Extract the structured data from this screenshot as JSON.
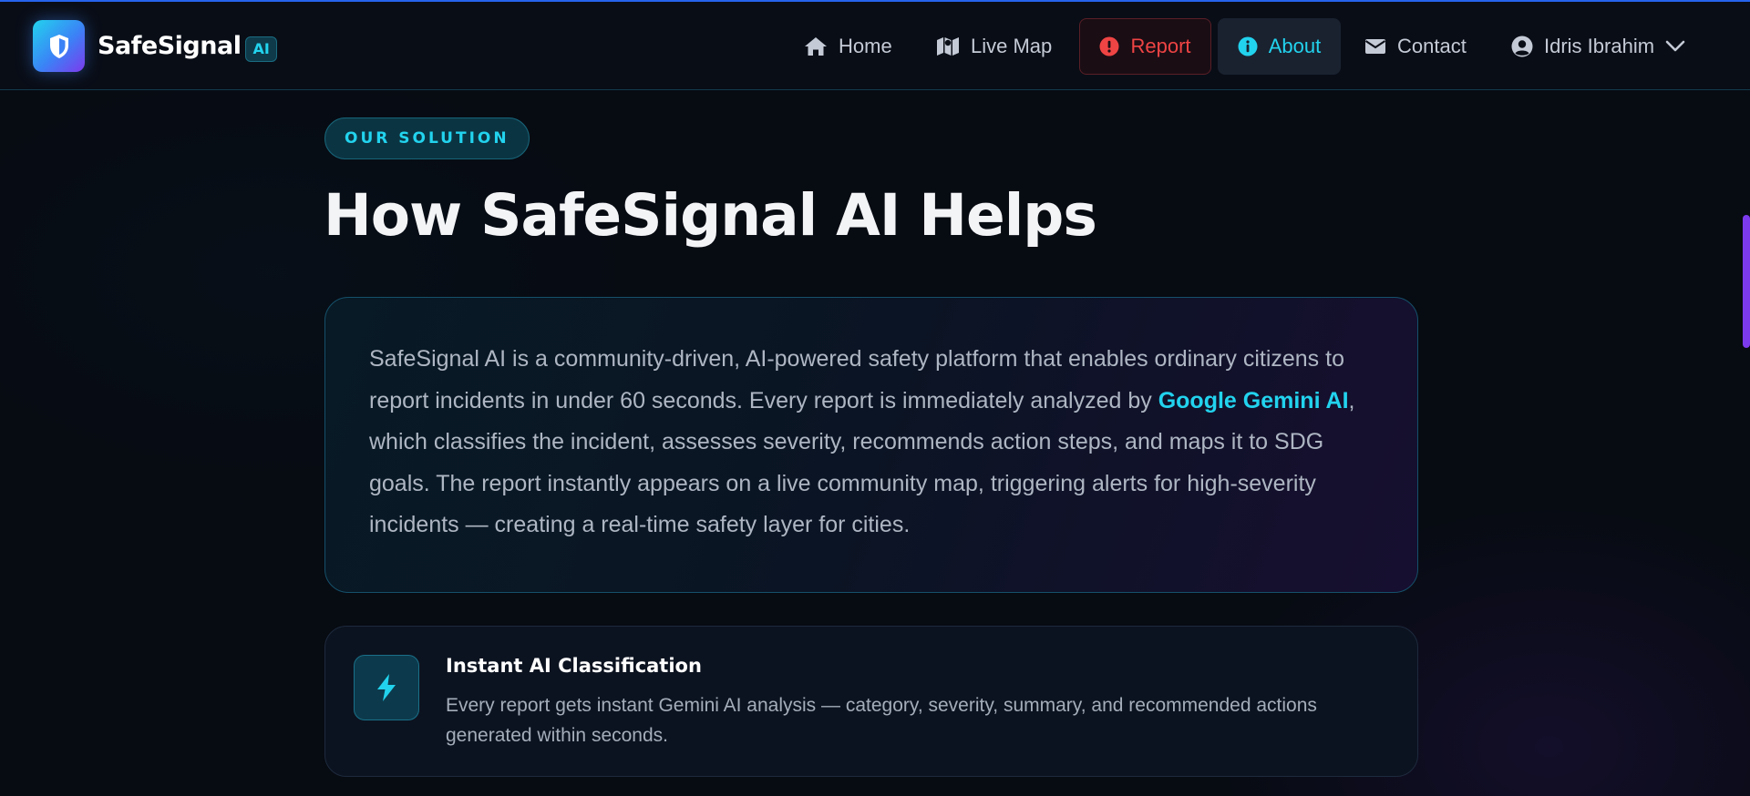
{
  "brand": {
    "name": "SafeSignal",
    "badge": "AI"
  },
  "nav": {
    "home": "Home",
    "live_map": "Live Map",
    "report": "Report",
    "about": "About",
    "contact": "Contact",
    "user": "Idris Ibrahim"
  },
  "section": {
    "eyebrow": "OUR SOLUTION",
    "title": "How SafeSignal AI Helps",
    "intro_part1": "SafeSignal AI is a community-driven, AI-powered safety platform that enables ordinary citizens to report incidents in under 60 seconds. Every report is immediately analyzed by ",
    "intro_highlight": "Google Gemini AI",
    "intro_part2": ", which classifies the incident, assesses severity, recommends action steps, and maps it to SDG goals. The report instantly appears on a live community map, triggering alerts for high-severity incidents — creating a real-time safety layer for cities."
  },
  "features": [
    {
      "icon": "bolt-icon",
      "title": "Instant AI Classification",
      "description": "Every report gets instant Gemini AI analysis — category, severity, summary, and recommended actions generated within seconds."
    }
  ],
  "colors": {
    "accent": "#22d3ee",
    "report": "#ef4444",
    "background": "#070b12",
    "scrollbar": "#7c3aed"
  }
}
